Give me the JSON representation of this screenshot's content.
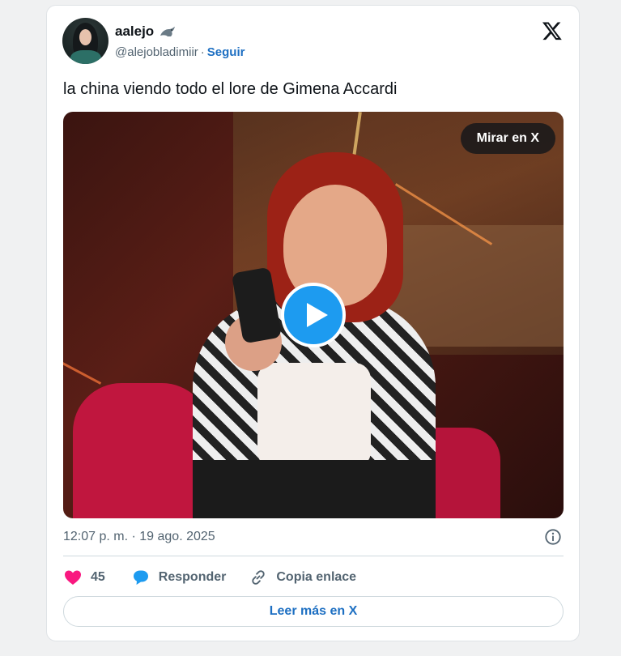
{
  "user": {
    "display_name": "aalejo",
    "handle": "@alejobladimiir",
    "separator": "·",
    "follow_label": "Seguir"
  },
  "icons": {
    "name_emoji": "seal-icon",
    "brand": "x-logo-icon",
    "info": "info-icon",
    "like": "heart-icon",
    "reply": "speech-bubble-icon",
    "copy": "link-icon",
    "play": "play-icon"
  },
  "tweet": {
    "text": "la china viendo todo el lore de Gimena Accardi"
  },
  "media": {
    "watch_label": "Mirar en X"
  },
  "meta": {
    "timestamp": "12:07 p. m. · 19 ago. 2025"
  },
  "actions": {
    "like_count": "45",
    "reply_label": "Responder",
    "copy_label": "Copia enlace"
  },
  "footer": {
    "read_more_label": "Leer más en X"
  },
  "colors": {
    "accent": "#1d9bf0",
    "link": "#1d6fc2",
    "like": "#f91880",
    "muted": "#536471"
  }
}
